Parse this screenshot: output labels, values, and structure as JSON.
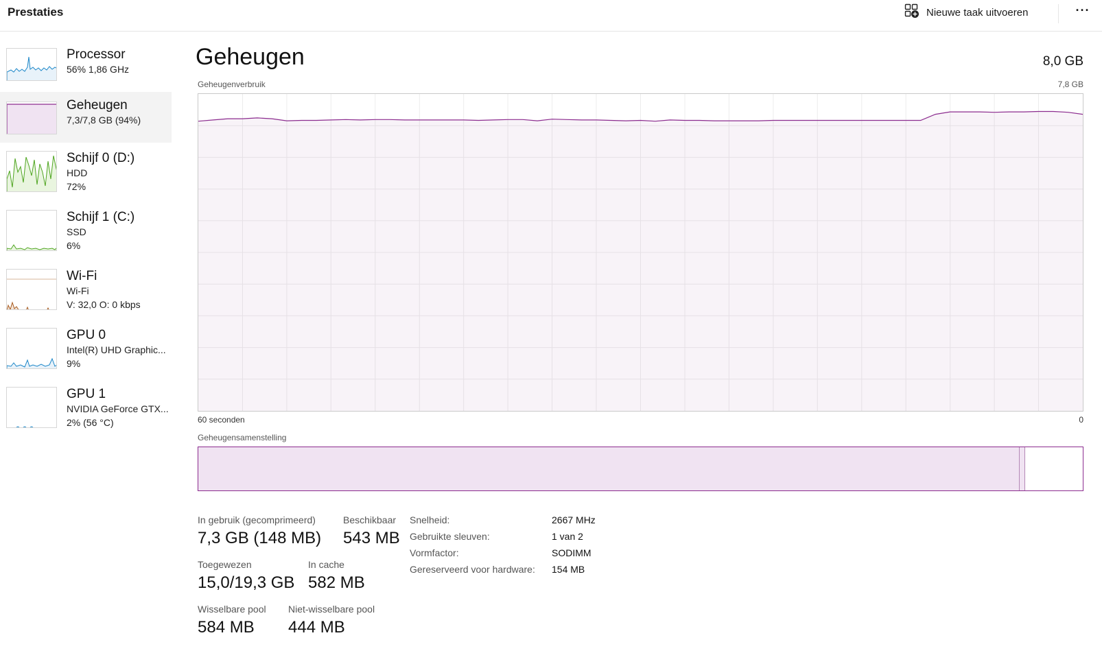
{
  "header": {
    "title": "Prestaties",
    "new_task_label": "Nieuwe taak uitvoeren",
    "new_task_icon": "run-new-task-icon",
    "more_label": "···"
  },
  "sidebar": {
    "items": [
      {
        "title": "Processor",
        "sub1": "56%  1,86 GHz",
        "sub2": "",
        "color": "#1a86c8"
      },
      {
        "title": "Geheugen",
        "sub1": "7,3/7,8 GB (94%)",
        "sub2": "",
        "color": "#8b2b8e"
      },
      {
        "title": "Schijf 0 (D:)",
        "sub1": "HDD",
        "sub2": "72%",
        "color": "#4da41e"
      },
      {
        "title": "Schijf 1 (C:)",
        "sub1": "SSD",
        "sub2": "6%",
        "color": "#4da41e"
      },
      {
        "title": "Wi-Fi",
        "sub1": "Wi-Fi",
        "sub2": "V: 32,0 O: 0 kbps",
        "color": "#a75a1e"
      },
      {
        "title": "GPU 0",
        "sub1": "Intel(R) UHD Graphic...",
        "sub2": "9%",
        "color": "#1a86c8"
      },
      {
        "title": "GPU 1",
        "sub1": "NVIDIA GeForce GTX...",
        "sub2": "2%  (56 °C)",
        "color": "#1a86c8"
      }
    ],
    "selected_index": 1
  },
  "main": {
    "title": "Geheugen",
    "total": "8,0 GB",
    "chart_label": "Geheugenverbruik",
    "chart_max_label": "7,8 GB",
    "axis_left": "60 seconden",
    "axis_right": "0",
    "composition_label": "Geheugensamenstelling",
    "composition": {
      "in_use_fraction": 0.929,
      "modified_fraction": 0.006
    },
    "stats": {
      "in_use_label": "In gebruik (gecomprimeerd)",
      "in_use_value": "7,3 GB (148 MB)",
      "available_label": "Beschikbaar",
      "available_value": "543 MB",
      "committed_label": "Toegewezen",
      "committed_value": "15,0/19,3 GB",
      "cached_label": "In cache",
      "cached_value": "582 MB",
      "paged_label": "Wisselbare pool",
      "paged_value": "584 MB",
      "nonpaged_label": "Niet-wisselbare pool",
      "nonpaged_value": "444 MB"
    },
    "specs": [
      {
        "label": "Snelheid:",
        "value": "2667 MHz"
      },
      {
        "label": "Gebruikte sleuven:",
        "value": "1 van 2"
      },
      {
        "label": "Vormfactor:",
        "value": "SODIMM"
      },
      {
        "label": "Gereserveerd voor hardware:",
        "value": "154 MB"
      }
    ]
  },
  "chart_data": {
    "type": "area",
    "title": "Geheugenverbruik",
    "xlabel": "60 seconden",
    "ylabel": "",
    "x_unit": "seconden",
    "xlim": [
      60,
      0
    ],
    "ylim": [
      0,
      7.8
    ],
    "color": "#8b2b8e",
    "grid": true,
    "x": [
      60,
      59,
      58,
      57,
      56,
      55,
      54,
      53,
      52,
      51,
      50,
      49,
      48,
      47,
      46,
      45,
      44,
      43,
      42,
      41,
      40,
      39,
      38,
      37,
      36,
      35,
      34,
      33,
      32,
      31,
      30,
      29,
      28,
      27,
      26,
      25,
      24,
      23,
      22,
      21,
      20,
      19,
      18,
      17,
      16,
      15,
      14,
      13,
      12,
      11,
      10,
      9,
      8,
      7,
      6,
      5,
      4,
      3,
      2,
      1,
      0
    ],
    "values": [
      7.13,
      7.16,
      7.19,
      7.19,
      7.21,
      7.19,
      7.14,
      7.15,
      7.15,
      7.16,
      7.17,
      7.16,
      7.17,
      7.17,
      7.16,
      7.16,
      7.16,
      7.16,
      7.16,
      7.15,
      7.16,
      7.17,
      7.17,
      7.14,
      7.18,
      7.17,
      7.16,
      7.16,
      7.15,
      7.14,
      7.15,
      7.13,
      7.16,
      7.15,
      7.15,
      7.14,
      7.14,
      7.14,
      7.14,
      7.15,
      7.15,
      7.15,
      7.15,
      7.15,
      7.15,
      7.15,
      7.15,
      7.15,
      7.15,
      7.15,
      7.3,
      7.36,
      7.36,
      7.36,
      7.35,
      7.36,
      7.36,
      7.37,
      7.37,
      7.35,
      7.3
    ]
  }
}
